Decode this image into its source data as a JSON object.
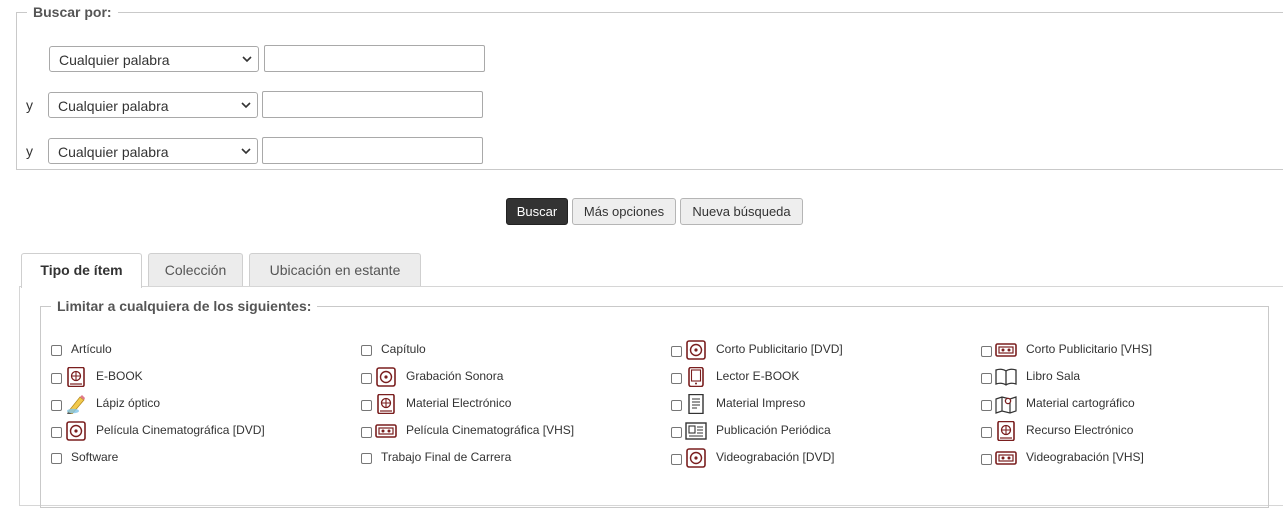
{
  "search": {
    "legend": "Buscar por:",
    "rows": [
      {
        "conjunction": "",
        "field": "Cualquier palabra",
        "value": ""
      },
      {
        "conjunction": "y",
        "field": "Cualquier palabra",
        "value": ""
      },
      {
        "conjunction": "y",
        "field": "Cualquier palabra",
        "value": ""
      }
    ]
  },
  "buttons": {
    "search": "Buscar",
    "more": "Más opciones",
    "new": "Nueva búsqueda"
  },
  "tabs": [
    {
      "label": "Tipo de ítem",
      "active": true
    },
    {
      "label": "Colección",
      "active": false
    },
    {
      "label": "Ubicación en estante",
      "active": false
    }
  ],
  "limit": {
    "legend": "Limitar a cualquiera de los siguientes:",
    "items": [
      {
        "label": "Artículo",
        "icon": ""
      },
      {
        "label": "Capítulo",
        "icon": ""
      },
      {
        "label": "Corto Publicitario [DVD]",
        "icon": "disc-icon"
      },
      {
        "label": "Corto Publicitario [VHS]",
        "icon": "vhs-icon"
      },
      {
        "label": "E-BOOK",
        "icon": "globe-book-icon"
      },
      {
        "label": "Grabación Sonora",
        "icon": "disc-icon"
      },
      {
        "label": "Lector E-BOOK",
        "icon": "ereader-icon"
      },
      {
        "label": "Libro Sala",
        "icon": "open-book-icon"
      },
      {
        "label": "Lápiz óptico",
        "icon": "pencil-icon"
      },
      {
        "label": "Material Electrónico",
        "icon": "globe-book-icon"
      },
      {
        "label": "Material Impreso",
        "icon": "document-icon"
      },
      {
        "label": "Material cartográfico",
        "icon": "map-icon"
      },
      {
        "label": "Película Cinematográfica [DVD]",
        "icon": "disc-icon"
      },
      {
        "label": "Película Cinematográfica [VHS]",
        "icon": "vhs-icon"
      },
      {
        "label": "Publicación Periódica",
        "icon": "newspaper-icon"
      },
      {
        "label": "Recurso Electrónico",
        "icon": "globe-book-icon"
      },
      {
        "label": "Software",
        "icon": ""
      },
      {
        "label": "Trabajo Final de Carrera",
        "icon": ""
      },
      {
        "label": "Videograbación [DVD]",
        "icon": "disc-icon"
      },
      {
        "label": "Videograbación [VHS]",
        "icon": "vhs-icon"
      }
    ]
  },
  "colors": {
    "icon": "#7a1f1f",
    "primary_button": "#333333"
  }
}
